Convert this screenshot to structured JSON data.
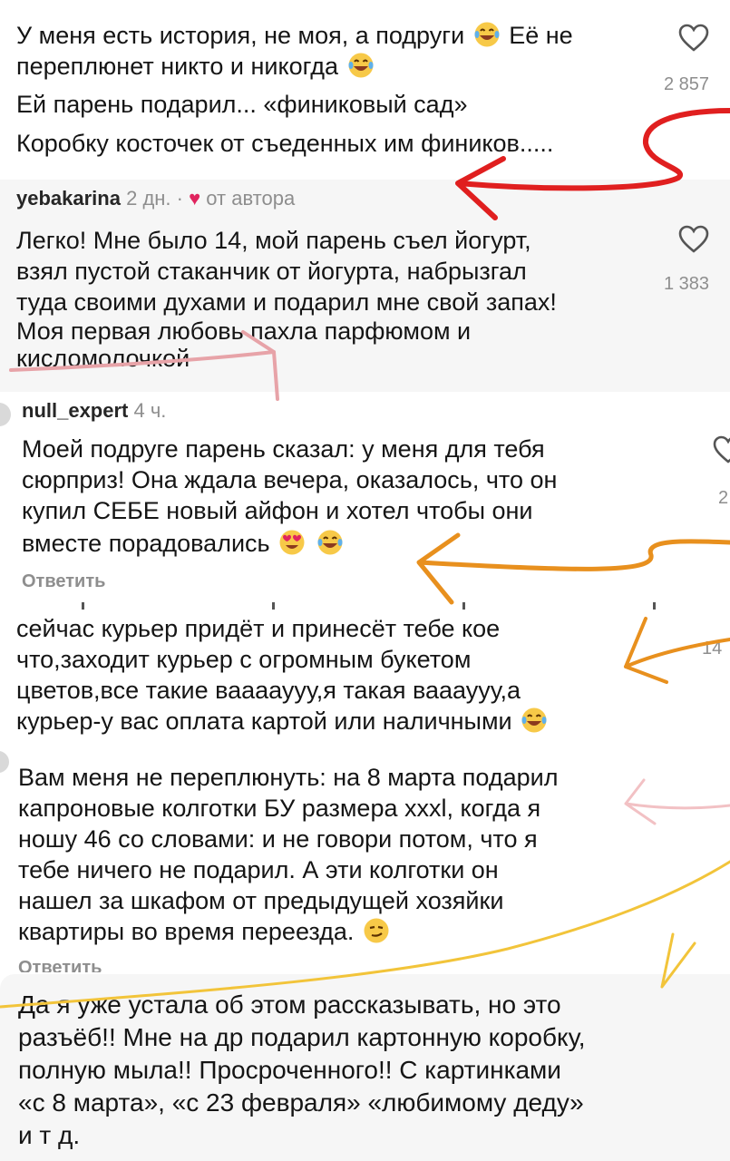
{
  "comments": [
    {
      "lines": [
        "У меня есть история, не моя, а подруги",
        "Её не",
        "переплюнет никто и никогда",
        "Ей парень подарил... «финиковый сад»",
        "Коробку косточек от съеденных им фиников....."
      ],
      "likes": "2 857"
    },
    {
      "username": "yebakarina",
      "meta": "2 дн. ·",
      "author_tag": "от автора",
      "lines": [
        "Легко! Мне было 14, мой парень съел йогурт,",
        "взял пустой стаканчик от йогурта, набрызгал",
        "туда своими духами и подарил мне свой запах!",
        "Моя первая любовь пахла парфюмом и",
        "кисломолочкой"
      ],
      "likes": "1 383"
    },
    {
      "username": "null_expert",
      "time": "4 ч.",
      "lines": [
        "Моей подруге парень сказал: у меня для тебя",
        "сюрприз! Она ждала вечера, оказалось, что он",
        "купил СЕБЕ новый айфон и хотел чтобы они",
        "вместе порадовались"
      ],
      "reply": "Ответить",
      "likes": "2"
    },
    {
      "lines": [
        "сейчас курьер придёт и принесёт тебе кое",
        "что,заходит курьер с огромным букетом",
        "цветов,все такие вааааууу,я такая ваааууу,а",
        "курьер-у вас оплата картой или наличными"
      ],
      "likes": "14"
    },
    {
      "lines": [
        "Вам меня не переплюнуть: на 8 марта подарил",
        "капроновые колготки БУ размера xxxl, когда я",
        "ношу 46 со словами: и не говори потом, что я",
        "тебе ничего не подарил. А эти колготки он",
        "нашел за шкафом от предыдущей хозяйки",
        "квартиры во время переезда."
      ],
      "reply": "Ответить"
    },
    {
      "lines": [
        "Да я уже устала об этом рассказывать, но это",
        "разъёб!! Мне на др подарил картонную коробку,",
        "полную  мыла!! Просроченного!! С картинками",
        "«с 8 марта», «с 23 февраля» «любимому деду»",
        "и т д."
      ]
    }
  ],
  "colors": {
    "arrow_red": "#e01f1f",
    "arrow_pink": "#e7a3a8",
    "arrow_orange": "#e8901e",
    "arrow_lightpink": "#f2c1c4",
    "arrow_gold": "#f2c43a",
    "text": "#151515",
    "muted": "#8e8e8e"
  }
}
